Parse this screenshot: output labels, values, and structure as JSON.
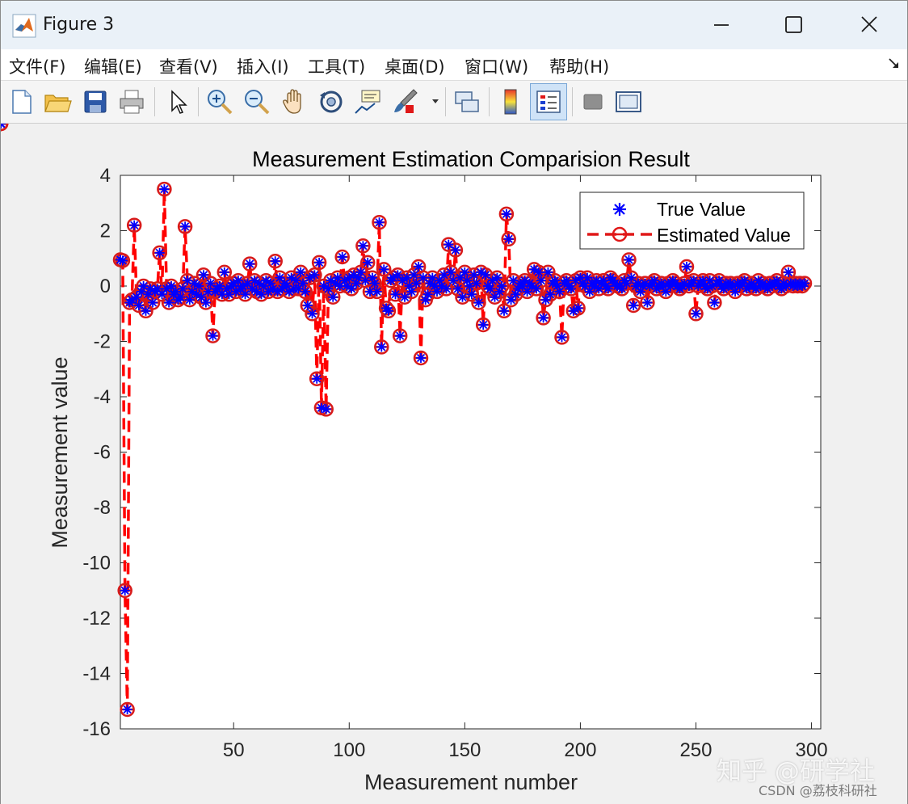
{
  "window": {
    "title": "Figure 3"
  },
  "menu": [
    {
      "label": "文件(F)"
    },
    {
      "label": "编辑(E)"
    },
    {
      "label": "查看(V)"
    },
    {
      "label": "插入(I)"
    },
    {
      "label": "工具(T)"
    },
    {
      "label": "桌面(D)"
    },
    {
      "label": "窗口(W)"
    },
    {
      "label": "帮助(H)"
    }
  ],
  "toolbar": {
    "buttons": [
      "new-figure-icon",
      "open-file-icon",
      "save-icon",
      "print-icon",
      "select-arrow-icon",
      "zoom-in-icon",
      "zoom-out-icon",
      "pan-hand-icon",
      "rotate-3d-icon",
      "data-cursor-icon",
      "brush-icon",
      "link-plot-icon",
      "colorbar-icon",
      "legend-icon",
      "hide-plot-tools-icon",
      "show-plot-tools-icon"
    ]
  },
  "watermark": {
    "main": "知乎 @研学社",
    "sub": "CSDN @荔枝科研社"
  },
  "colors": {
    "true_marker": "#0000ff",
    "estimated_line": "#ff0000",
    "estimated_marker_edge": "#d81b1b"
  },
  "chart_data": {
    "type": "line",
    "title": "Measurement Estimation Comparision Result",
    "xlabel": "Measurement number",
    "ylabel": "Measurement value",
    "xlim": [
      1,
      304
    ],
    "ylim": [
      -16,
      4
    ],
    "xticks": [
      50,
      100,
      150,
      200,
      250,
      300
    ],
    "yticks": [
      4,
      2,
      0,
      -2,
      -4,
      -6,
      -8,
      -10,
      -12,
      -14,
      -16
    ],
    "legend_position": "top-right",
    "series": [
      {
        "name": "True Value",
        "style": "markers-asterisk"
      },
      {
        "name": "Estimated Value",
        "style": "dashed-line-circle"
      }
    ],
    "x": [
      1,
      2,
      3,
      4,
      5,
      6,
      7,
      8,
      9,
      10,
      11,
      12,
      13,
      14,
      15,
      16,
      17,
      18,
      19,
      20,
      21,
      22,
      23,
      24,
      25,
      26,
      27,
      28,
      29,
      30,
      31,
      32,
      33,
      34,
      35,
      36,
      37,
      38,
      39,
      40,
      41,
      42,
      43,
      44,
      45,
      46,
      47,
      48,
      49,
      50,
      51,
      52,
      53,
      54,
      55,
      56,
      57,
      58,
      59,
      60,
      61,
      62,
      63,
      64,
      65,
      66,
      67,
      68,
      69,
      70,
      71,
      72,
      73,
      74,
      75,
      76,
      77,
      78,
      79,
      80,
      81,
      82,
      83,
      84,
      85,
      86,
      87,
      88,
      89,
      90,
      91,
      92,
      93,
      94,
      95,
      96,
      97,
      98,
      99,
      100,
      101,
      102,
      103,
      104,
      105,
      106,
      107,
      108,
      109,
      110,
      111,
      112,
      113,
      114,
      115,
      116,
      117,
      118,
      119,
      120,
      121,
      122,
      123,
      124,
      125,
      126,
      127,
      128,
      129,
      130,
      131,
      132,
      133,
      134,
      135,
      136,
      137,
      138,
      139,
      140,
      141,
      142,
      143,
      144,
      145,
      146,
      147,
      148,
      149,
      150,
      151,
      152,
      153,
      154,
      155,
      156,
      157,
      158,
      159,
      160,
      161,
      162,
      163,
      164,
      165,
      166,
      167,
      168,
      169,
      170,
      171,
      172,
      173,
      174,
      175,
      176,
      177,
      178,
      179,
      180,
      181,
      182,
      183,
      184,
      185,
      186,
      187,
      188,
      189,
      190,
      191,
      192,
      193,
      194,
      195,
      196,
      197,
      198,
      199,
      200,
      201,
      202,
      203,
      204,
      205,
      206,
      207,
      208,
      209,
      210,
      211,
      212,
      213,
      214,
      215,
      216,
      217,
      218,
      219,
      220,
      221,
      222,
      223,
      224,
      225,
      226,
      227,
      228,
      229,
      230,
      231,
      232,
      233,
      234,
      235,
      236,
      237,
      238,
      239,
      240,
      241,
      242,
      243,
      244,
      245,
      246,
      247,
      248,
      249,
      250,
      251,
      252,
      253,
      254,
      255,
      256,
      257,
      258,
      259,
      260,
      261,
      262,
      263,
      264,
      265,
      266,
      267,
      268,
      269,
      270,
      271,
      272,
      273,
      274,
      275,
      276,
      277,
      278,
      279,
      280,
      281,
      282,
      283,
      284,
      285,
      286,
      287,
      288,
      289,
      290,
      291,
      292,
      293,
      294,
      295,
      296,
      297,
      298,
      299,
      300,
      301,
      302,
      303,
      304
    ],
    "y": [
      0.95,
      0.92,
      -11.0,
      -15.3,
      -0.6,
      -0.5,
      2.2,
      -0.4,
      -0.7,
      -0.2,
      0.0,
      -0.9,
      -0.3,
      -0.1,
      -0.6,
      -0.2,
      -0.1,
      1.2,
      -0.3,
      3.5,
      -0.1,
      -0.6,
      0.0,
      -0.3,
      -0.2,
      -0.5,
      -0.4,
      -0.1,
      2.15,
      0.2,
      -0.5,
      -0.2,
      0.1,
      -0.3,
      0.0,
      -0.4,
      0.4,
      -0.6,
      -0.2,
      0.1,
      -1.8,
      -0.2,
      -0.1,
      0.0,
      -0.3,
      0.5,
      -0.1,
      -0.3,
      0.0,
      0.1,
      -0.2,
      0.2,
      -0.1,
      0.0,
      -0.3,
      0.1,
      0.8,
      -0.1,
      0.2,
      -0.2,
      0.1,
      -0.3,
      0.0,
      0.2,
      -0.2,
      0.1,
      -0.1,
      0.9,
      -0.2,
      0.3,
      -0.1,
      0.1,
      0.0,
      -0.2,
      0.3,
      -0.1,
      0.2,
      -0.1,
      0.5,
      0.1,
      -0.2,
      -0.7,
      0.3,
      -1.0,
      0.4,
      -3.35,
      0.85,
      -4.4,
      0.0,
      -4.45,
      -0.1,
      0.2,
      -0.4,
      0.1,
      0.3,
      0.0,
      1.05,
      0.2,
      0.0,
      0.3,
      -0.1,
      0.4,
      0.1,
      0.3,
      0.5,
      1.45,
      0.2,
      0.85,
      -0.2,
      0.3,
      0.1,
      -0.2,
      2.3,
      -2.2,
      0.6,
      -0.8,
      -0.9,
      0.2,
      0.3,
      -0.3,
      0.4,
      -1.8,
      0.2,
      -0.4,
      0.3,
      0.0,
      -0.2,
      0.4,
      0.1,
      0.7,
      -2.6,
      0.3,
      -0.5,
      -0.3,
      0.1,
      0.3,
      0.0,
      -0.2,
      0.2,
      0.0,
      0.4,
      -0.1,
      1.5,
      0.5,
      0.2,
      1.3,
      -0.1,
      0.3,
      -0.4,
      0.5,
      0.2,
      0.0,
      -0.3,
      0.4,
      0.1,
      -0.6,
      0.5,
      -1.4,
      0.4,
      0.0,
      -0.1,
      0.2,
      -0.4,
      0.3,
      -0.2,
      0.0,
      -0.9,
      2.6,
      1.7,
      -0.5,
      0.2,
      -0.3,
      -0.1,
      0.1,
      0.0,
      0.2,
      -0.2,
      0.1,
      0.0,
      0.6,
      -0.1,
      0.5,
      0.2,
      -1.15,
      -0.5,
      0.5,
      -0.3,
      0.1,
      0.2,
      0.0,
      -0.2,
      -1.85,
      0.1,
      0.2,
      0.0,
      -0.1,
      -0.9,
      0.2,
      -0.8,
      0.3,
      0.1,
      0.0,
      0.3,
      -0.2,
      0.1,
      0.0,
      0.2,
      -0.1,
      0.1,
      0.2,
      0.0,
      -0.1,
      0.3,
      0.2,
      0.1,
      0.0,
      0.0,
      -0.1,
      0.2,
      0.1,
      0.95,
      0.3,
      -0.7,
      0.0,
      0.1,
      -0.2,
      0.0,
      0.1,
      -0.6,
      0.0,
      0.1,
      0.2,
      -0.1,
      0.0,
      0.1,
      0.0,
      -0.2,
      0.1,
      0.0,
      0.2,
      0.1,
      0.0,
      -0.1,
      0.0,
      0.1,
      0.7,
      0.0,
      0.1,
      0.2,
      -1.0,
      0.0,
      0.1,
      0.2,
      0.0,
      -0.1,
      0.2,
      0.0,
      -0.6,
      0.1,
      0.2,
      0.0,
      -0.1,
      0.1,
      0.0,
      0.1,
      0.0,
      -0.2,
      0.1,
      0.0,
      0.1,
      0.2,
      -0.1,
      0.0,
      0.1,
      0.0,
      -0.1,
      0.2,
      0.0,
      0.1,
      0.0,
      -0.1,
      0.1,
      0.0,
      0.1,
      0.2,
      0.0,
      -0.1,
      0.1,
      0.0,
      0.5,
      0.1,
      0.0,
      0.1,
      0.0,
      0.1,
      0.0,
      0.1
    ]
  }
}
